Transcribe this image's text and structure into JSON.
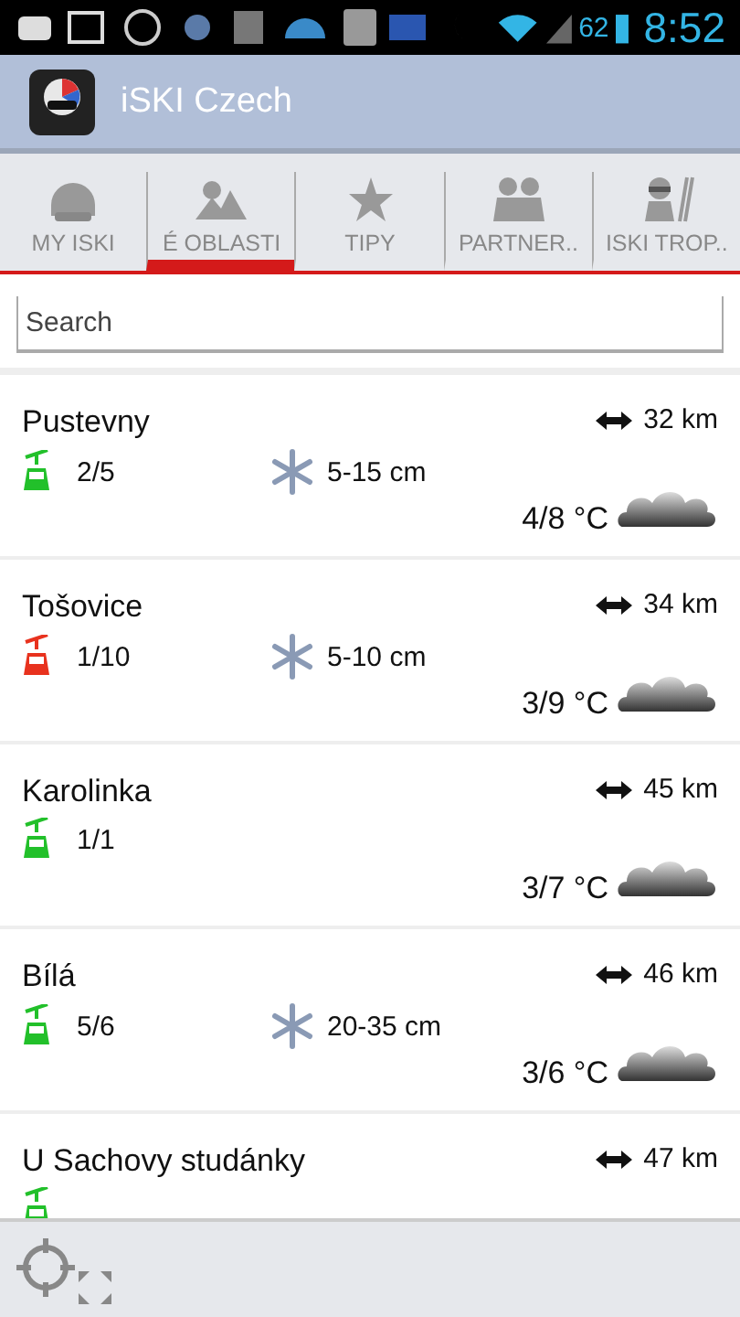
{
  "status_bar": {
    "battery": "62",
    "time": "8:52"
  },
  "app_bar": {
    "title": "iSKI Czech"
  },
  "tabs": [
    {
      "label": "MY ISKI",
      "kind": "helmet",
      "selected": false
    },
    {
      "label": "É OBLASTI",
      "kind": "mountain",
      "selected": true
    },
    {
      "label": "TIPY",
      "kind": "star",
      "selected": false
    },
    {
      "label": "PARTNER..",
      "kind": "people",
      "selected": false
    },
    {
      "label": "ISKI TROP..",
      "kind": "skier",
      "selected": false
    }
  ],
  "search": {
    "placeholder": "Search"
  },
  "resorts": [
    {
      "name": "Pustevny",
      "lifts": "2/5",
      "color": "#22c02a",
      "snow": "5-15 cm",
      "distance": "32 km",
      "temperature": "4/8 °C"
    },
    {
      "name": "Tošovice",
      "lifts": "1/10",
      "color": "#e8321e",
      "snow": "5-10 cm",
      "distance": "34 km",
      "temperature": "3/9 °C"
    },
    {
      "name": "Karolinka",
      "lifts": "1/1",
      "color": "#22c02a",
      "distance": "45 km",
      "temperature": "3/7 °C"
    },
    {
      "name": "Bílá",
      "lifts": "5/6",
      "color": "#22c02a",
      "snow": "20-35 cm",
      "distance": "46 km",
      "temperature": "3/6 °C"
    },
    {
      "name": "U Sachovy studánky",
      "color": "#22c02a",
      "distance": "47 km"
    }
  ]
}
